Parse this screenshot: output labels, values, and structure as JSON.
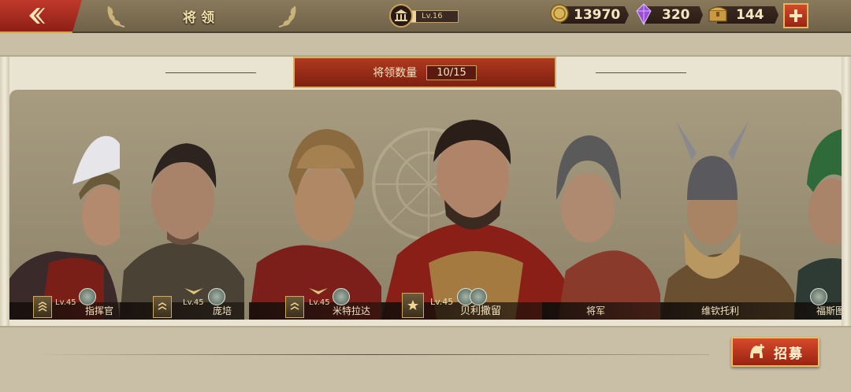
{
  "header": {
    "title": "将领",
    "player_level": "Lv.16",
    "level_progress": 0.12,
    "resources": {
      "gold": "13970",
      "gems": "320",
      "tokens": "144"
    },
    "icons": {
      "back": "back-arrow-icon",
      "level": "temple-icon",
      "gold": "gold-coin-icon",
      "gems": "purple-crystal-icon",
      "tokens": "treasure-chest-icon",
      "plus": "plus-icon"
    }
  },
  "roster": {
    "count_label": "将领数量",
    "count_value": "10/15"
  },
  "generals": [
    {
      "name": "指挥官",
      "level": "Lv.45"
    },
    {
      "name": "庞培",
      "level": "Lv.45"
    },
    {
      "name": "米特拉达",
      "level": "Lv.45"
    },
    {
      "name": "贝利撒留",
      "level": "Lv.45"
    },
    {
      "name": "将军",
      "level": ""
    },
    {
      "name": "维钦托利",
      "level": ""
    },
    {
      "name": "福斯图",
      "level": ""
    }
  ],
  "footer": {
    "recruit_label": "招募"
  },
  "colors": {
    "accent_red": "#b03a1f",
    "gold_trim": "#d9b163",
    "panel_bg": "#e9e3d1"
  }
}
